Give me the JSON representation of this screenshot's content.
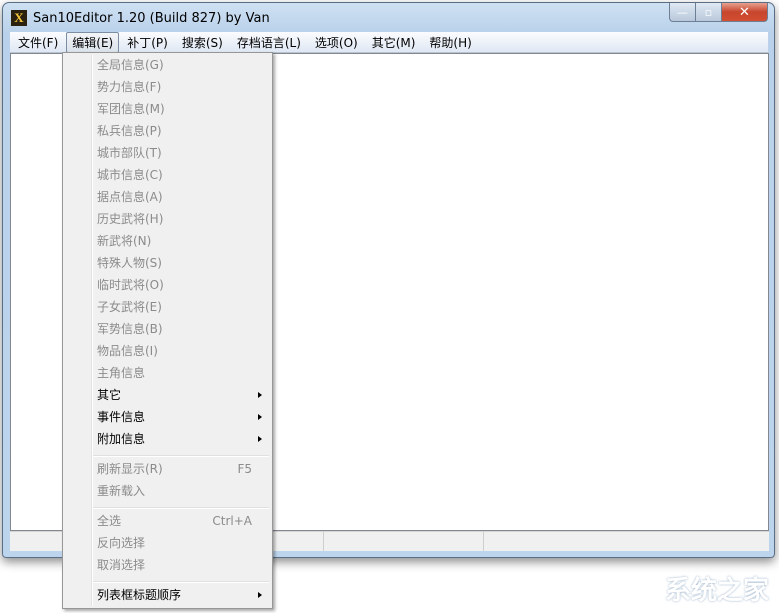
{
  "window": {
    "title": "San10Editor 1.20 (Build 827) by Van",
    "icon_letter": "X",
    "minimize": "—",
    "maximize": "▫",
    "close": "✕"
  },
  "menubar": [
    {
      "label": "文件(F)"
    },
    {
      "label": "编辑(E)"
    },
    {
      "label": "补丁(P)"
    },
    {
      "label": "搜索(S)"
    },
    {
      "label": "存档语言(L)"
    },
    {
      "label": "选项(O)"
    },
    {
      "label": "其它(M)"
    },
    {
      "label": "帮助(H)"
    }
  ],
  "edit_menu": {
    "group1": [
      {
        "label": "全局信息(G)"
      },
      {
        "label": "势力信息(F)"
      },
      {
        "label": "军团信息(M)"
      },
      {
        "label": "私兵信息(P)"
      },
      {
        "label": "城市部队(T)"
      },
      {
        "label": "城市信息(C)"
      },
      {
        "label": "据点信息(A)"
      },
      {
        "label": "历史武将(H)"
      },
      {
        "label": "新武将(N)"
      },
      {
        "label": "特殊人物(S)"
      },
      {
        "label": "临时武将(O)"
      },
      {
        "label": "子女武将(E)"
      },
      {
        "label": "军势信息(B)"
      },
      {
        "label": "物品信息(I)"
      },
      {
        "label": "主角信息"
      }
    ],
    "submenus": [
      {
        "label": "其它"
      },
      {
        "label": "事件信息"
      },
      {
        "label": "附加信息"
      }
    ],
    "refresh": {
      "label": "刷新显示(R)",
      "shortcut": "F5"
    },
    "reload": {
      "label": "重新载入"
    },
    "select_all": {
      "label": "全选",
      "shortcut": "Ctrl+A"
    },
    "invert": {
      "label": "反向选择"
    },
    "deselect": {
      "label": "取消选择"
    },
    "column_order": {
      "label": "列表框标题顺序"
    }
  },
  "watermark": "系统之家"
}
